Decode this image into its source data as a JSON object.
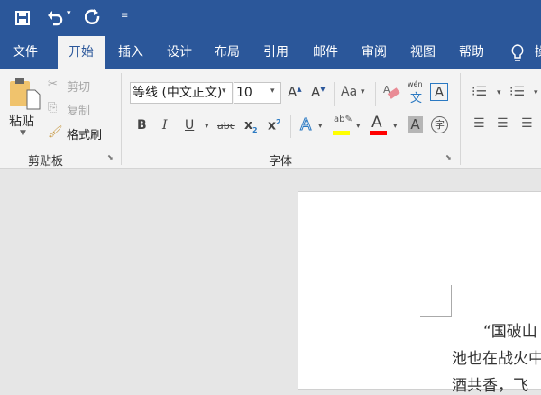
{
  "titlebar": {
    "icons": [
      "save-icon",
      "undo-icon",
      "redo-icon",
      "customize-quick-access-icon"
    ]
  },
  "tabs": [
    {
      "label": "文件"
    },
    {
      "label": "开始",
      "active": true
    },
    {
      "label": "插入"
    },
    {
      "label": "设计"
    },
    {
      "label": "布局"
    },
    {
      "label": "引用"
    },
    {
      "label": "邮件"
    },
    {
      "label": "审阅"
    },
    {
      "label": "视图"
    },
    {
      "label": "帮助"
    },
    {
      "label": "操"
    }
  ],
  "clipboard": {
    "paste": "粘贴",
    "cut": "剪切",
    "copy": "复制",
    "format_painter": "格式刷",
    "group": "剪贴板"
  },
  "font": {
    "name": "等线 (中文正文)",
    "size": "10",
    "case_label": "Aa",
    "bold": "B",
    "italic": "I",
    "underline": "U",
    "strike": "abc",
    "group": "字体",
    "highlight_color": "#ffff00",
    "font_color": "#ff0000"
  },
  "document": {
    "lines": [
      "“国破山",
      "池也在战火中",
      "酒共香，飞"
    ]
  },
  "colors": {
    "accent": "#2b579a"
  }
}
